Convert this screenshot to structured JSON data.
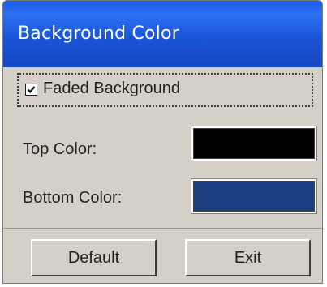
{
  "window": {
    "title": "Background Color"
  },
  "options": {
    "faded_label": "Faded Background",
    "faded_checked": true
  },
  "colors": {
    "top_label": "Top Color:",
    "top_value": "#000000",
    "bottom_label": "Bottom Color:",
    "bottom_value": "#1b3f82"
  },
  "buttons": {
    "default_label": "Default",
    "exit_label": "Exit"
  }
}
